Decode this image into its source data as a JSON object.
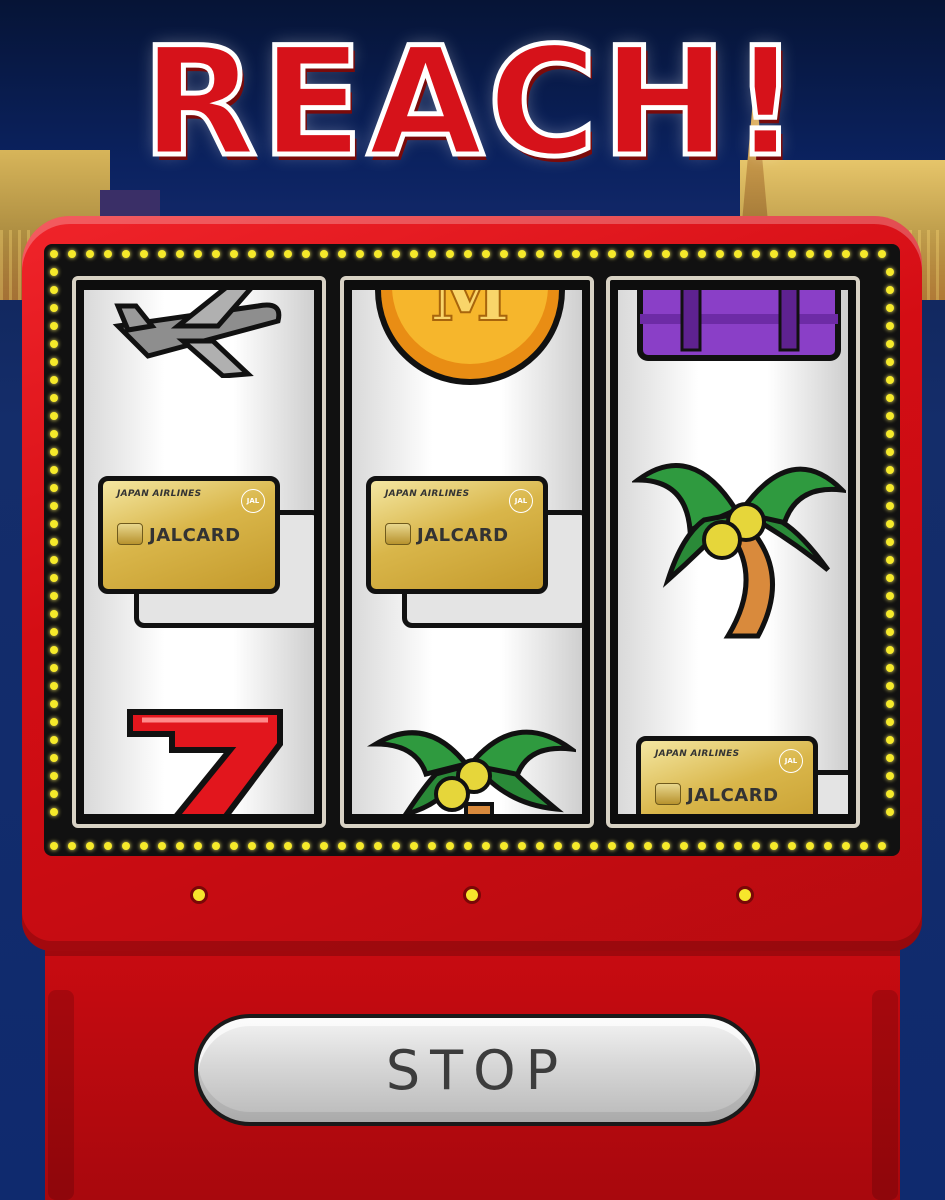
{
  "title": "REACH!",
  "stop_button": {
    "label": "STOP"
  },
  "card": {
    "airline": "JAPAN AIRLINES",
    "name": "JALCARD",
    "logo_mark": "JAL"
  },
  "reels": [
    {
      "id": "reel-1",
      "symbols": [
        "airplane-icon",
        "jalcard-icon",
        "seven-icon"
      ]
    },
    {
      "id": "reel-2",
      "symbols": [
        "m-coin-icon",
        "jalcard-icon",
        "palm-tree-icon"
      ]
    },
    {
      "id": "reel-3",
      "symbols": [
        "suitcase-icon",
        "palm-tree-icon",
        "jalcard-icon"
      ]
    }
  ],
  "colors": {
    "machine": "#d40d14",
    "bulb": "#f6ea2a",
    "button": "#d7d7d7",
    "sky": "#0b2260"
  }
}
